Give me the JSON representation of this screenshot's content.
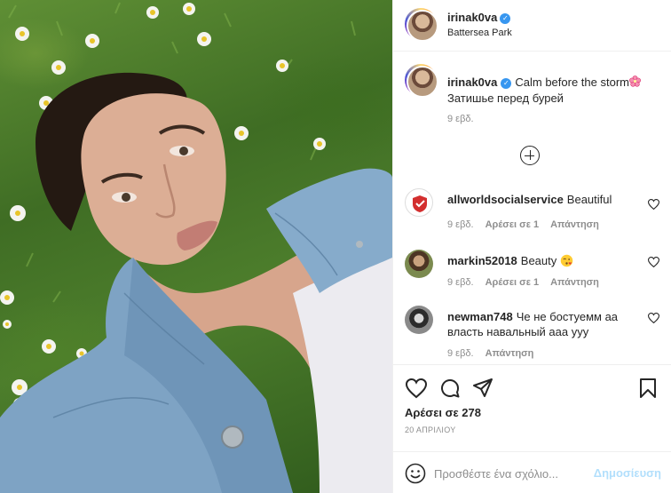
{
  "post": {
    "username": "irinak0va",
    "verified_icon": "verified-badge-icon",
    "location": "Battersea Park",
    "caption": {
      "text_before_emoji": "Calm before the storm",
      "emoji": "cherry-blossom-icon",
      "second_line": "Затишье перед бурей",
      "time": "9 εβδ."
    },
    "likes": "Αρέσει σε 278",
    "date": "20 ΑΠΡΙΛΙΟΥ"
  },
  "comments": [
    {
      "username": "allworldsocialservice",
      "text": "Beautiful",
      "time": "9 εβδ.",
      "likes": "Αρέσει σε 1",
      "reply": "Απάντηση"
    },
    {
      "username": "markin52018",
      "text": "Beauty",
      "emoji": "face-blowing-kiss-icon",
      "time": "9 εβδ.",
      "likes": "Αρέσει σε 1",
      "reply": "Απάντηση"
    },
    {
      "username": "newman748",
      "text": "Че не бостуемм аа власть навальный ааа ууу",
      "time": "9 εβδ.",
      "reply": "Απάντηση"
    }
  ],
  "add_comment": {
    "placeholder": "Προσθέστε ένα σχόλιο...",
    "publish_label": "Δημοσίευση"
  },
  "colors": {
    "link_blue": "#3897f0",
    "publish_disabled": "#b2dffc",
    "muted_text": "#8e8e8e"
  }
}
